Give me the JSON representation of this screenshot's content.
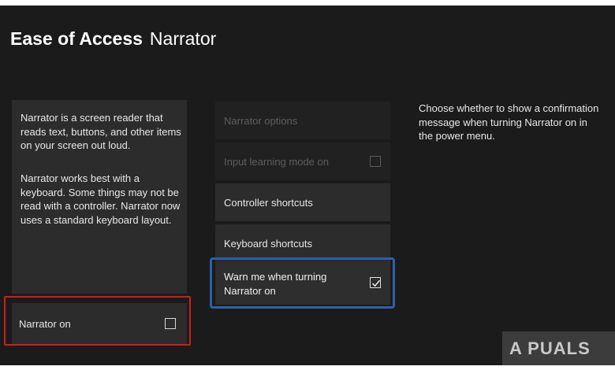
{
  "header": {
    "section": "Ease of Access",
    "page": "Narrator"
  },
  "info": {
    "paragraph1": "Narrator is a screen reader that reads text, buttons, and other items on your screen out loud.",
    "paragraph2": "Narrator works best with a keyboard. Some things may not be read with a controller. Narrator now uses a standard keyboard layout."
  },
  "narrator_toggle": {
    "label": "Narrator on",
    "checked": false
  },
  "menu": {
    "narrator_options": "Narrator options",
    "input_learning": {
      "label": "Input learning mode on",
      "checked": false
    },
    "controller_shortcuts": "Controller shortcuts",
    "keyboard_shortcuts": "Keyboard shortcuts",
    "warn_option": {
      "label": "Warn me when turning Narrator on",
      "checked": true
    }
  },
  "description": "Choose whether to show a confirmation message when turning Narrator on in the power menu.",
  "watermark": "A PUALS",
  "colors": {
    "background": "#1b1b1b",
    "panel": "#2c2c2c",
    "highlight_red": "#d01c1c",
    "focus_blue": "#2e5fab"
  }
}
